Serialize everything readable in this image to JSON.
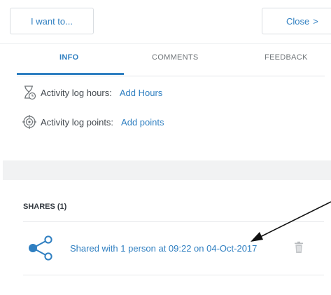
{
  "toolbar": {
    "iwant_label": "I want to...",
    "close_label": "Close",
    "close_chevron": ">"
  },
  "tabs": [
    {
      "label": "INFO",
      "active": true
    },
    {
      "label": "COMMENTS",
      "active": false
    },
    {
      "label": "FEEDBACK",
      "active": false
    }
  ],
  "info": {
    "hours_label": "Activity log hours:",
    "hours_link": "Add Hours",
    "points_label": "Activity log points:",
    "points_link": "Add points"
  },
  "shares": {
    "header": "SHARES (1)",
    "items": [
      {
        "text": "Shared with 1 person at 09:22 on 04-Oct-2017"
      }
    ]
  },
  "icons": {
    "hourglass": "hourglass-icon",
    "target": "target-icon",
    "share": "share-icon",
    "trash": "trash-icon"
  },
  "colors": {
    "accent": "#2f7fc1",
    "text": "#444a50",
    "muted": "#6f7478",
    "divider": "#e3e6e9",
    "band": "#f1f2f3"
  }
}
